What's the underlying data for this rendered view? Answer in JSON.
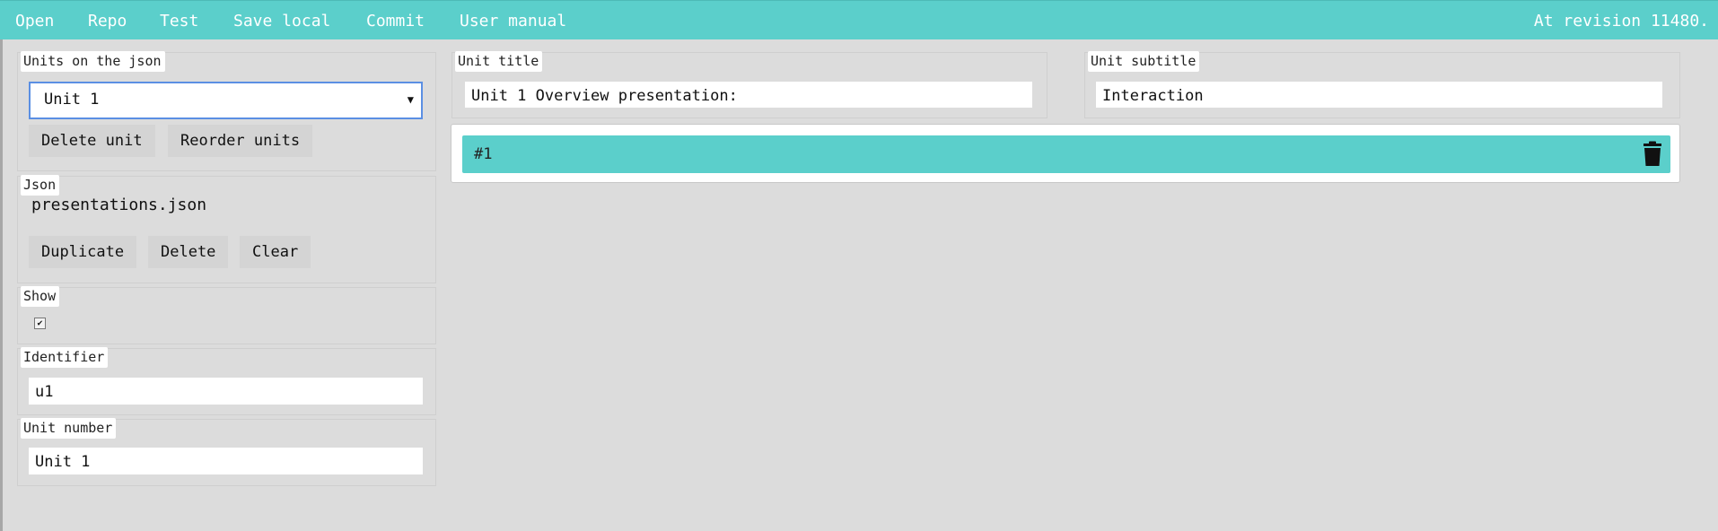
{
  "menu": {
    "items": [
      "Open",
      "Repo",
      "Test",
      "Save local",
      "Commit",
      "User manual"
    ],
    "revision": "At revision 11480."
  },
  "units_panel": {
    "legend": "Units on the json",
    "selected_unit": "Unit 1",
    "delete_label": "Delete unit",
    "reorder_label": "Reorder units"
  },
  "json_panel": {
    "legend": "Json",
    "file_name": "presentations.json",
    "duplicate_label": "Duplicate",
    "delete_label": "Delete",
    "clear_label": "Clear"
  },
  "show_panel": {
    "legend": "Show",
    "checked": true
  },
  "identifier_panel": {
    "legend": "Identifier",
    "value": "u1"
  },
  "unit_number_panel": {
    "legend": "Unit number",
    "value": "Unit 1"
  },
  "unit_title_panel": {
    "legend": "Unit title",
    "value": "Unit 1 Overview presentation:"
  },
  "unit_subtitle_panel": {
    "legend": "Unit subtitle",
    "value": "Interaction"
  },
  "item_card": {
    "label": "#1",
    "icon": "trash-icon"
  },
  "colors": {
    "accent": "#5bcfcb",
    "background": "#dcdcdc",
    "focus_border": "#5b8fe3"
  }
}
